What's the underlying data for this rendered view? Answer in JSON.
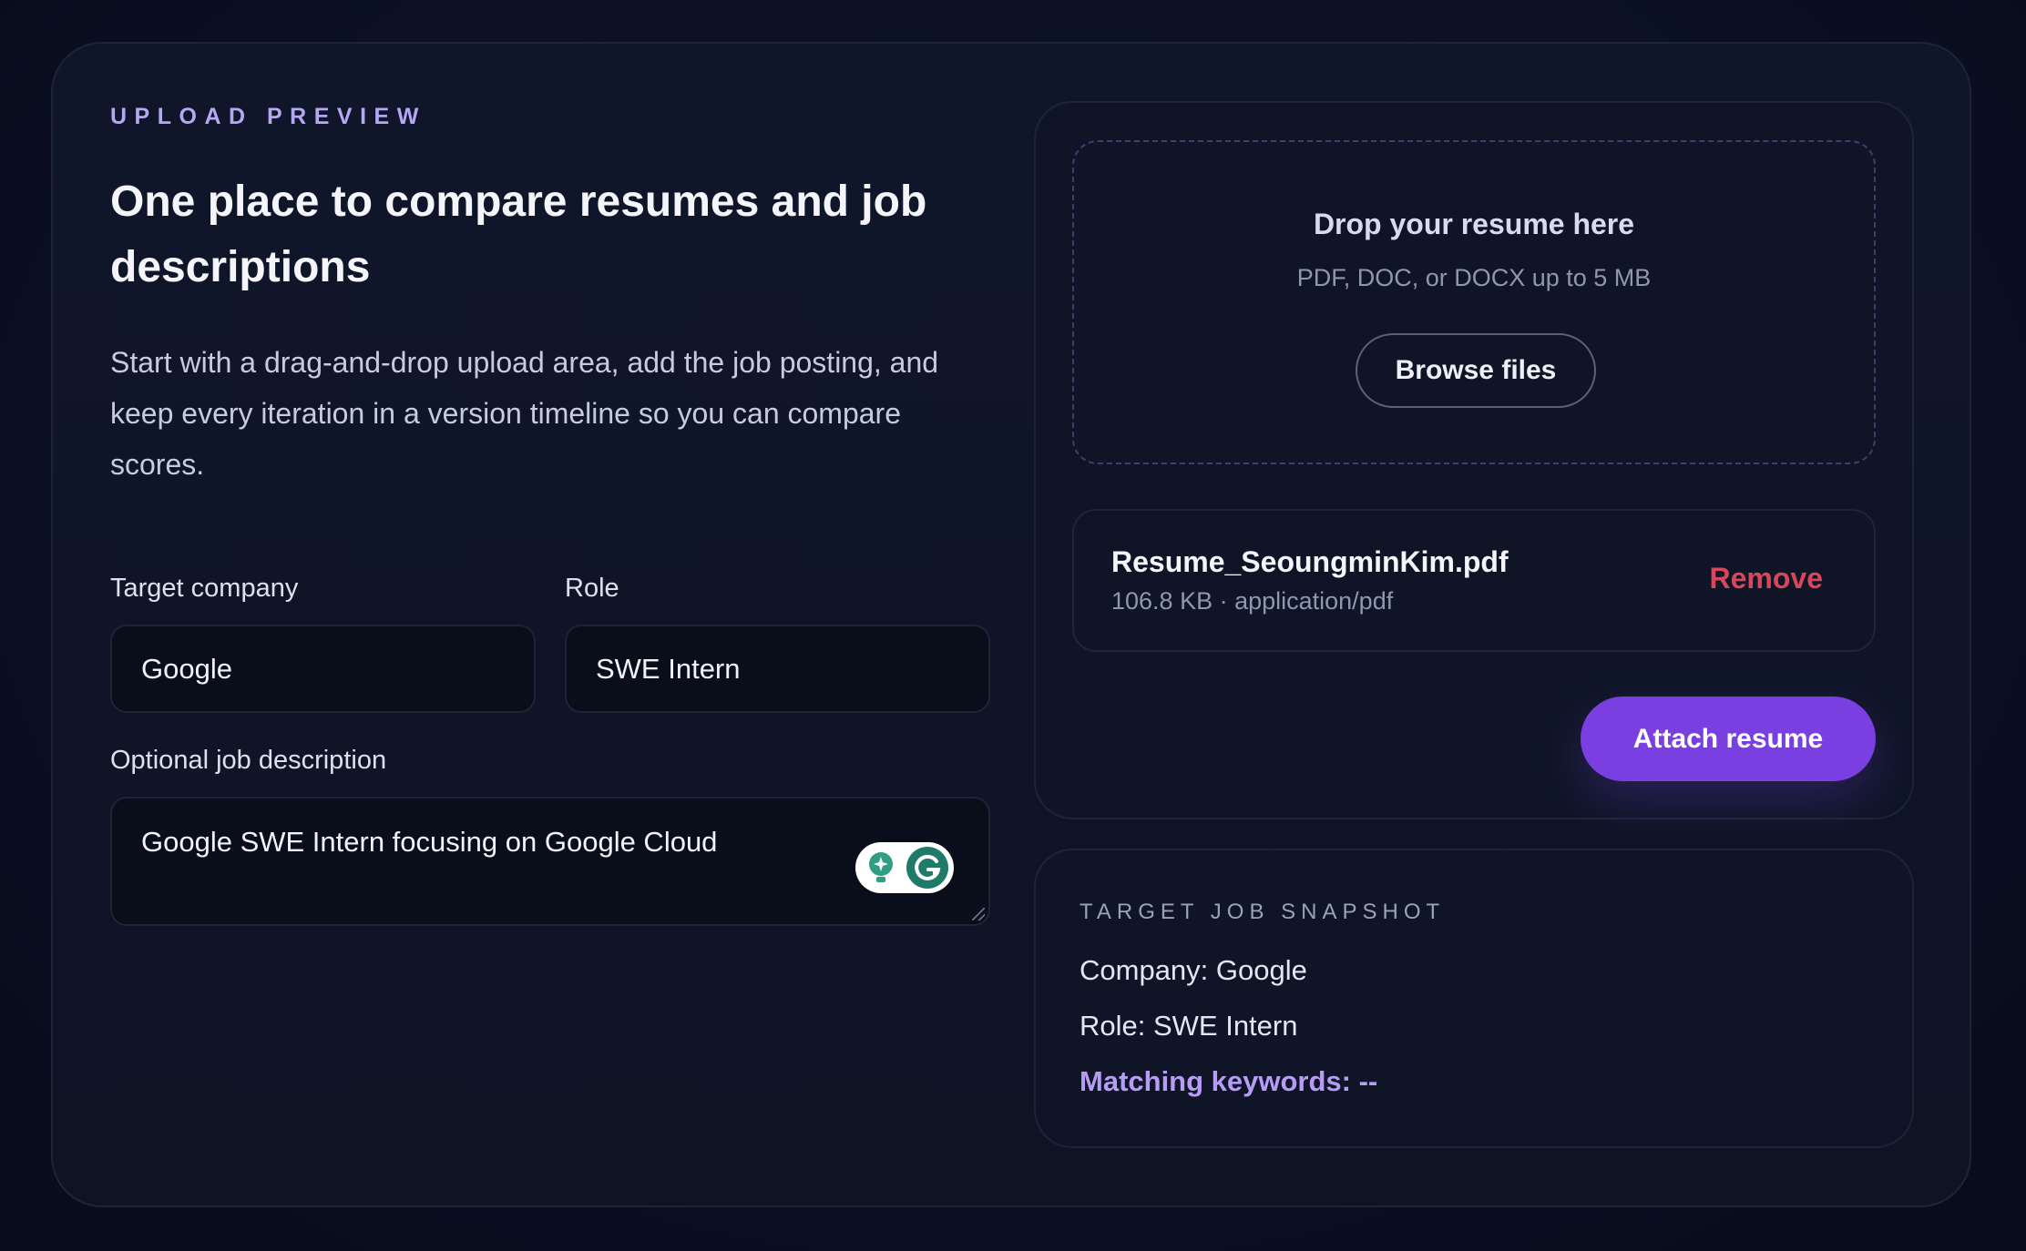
{
  "intro": {
    "eyebrow": "UPLOAD PREVIEW",
    "headline": "One place to compare resumes and job descriptions",
    "description": "Start with a drag-and-drop upload area, add the job posting, and keep every iteration in a version timeline so you can compare scores."
  },
  "form": {
    "company_label": "Target company",
    "company_value": "Google",
    "role_label": "Role",
    "role_value": "SWE Intern",
    "jd_label": "Optional job description",
    "jd_value": "Google SWE Intern focusing on Google Cloud"
  },
  "upload": {
    "drop_title": "Drop your resume here",
    "drop_hint": "PDF, DOC, or DOCX up to 5 MB",
    "browse_label": "Browse files",
    "file_name": "Resume_SeoungminKim.pdf",
    "file_meta": "106.8 KB · application/pdf",
    "remove_label": "Remove",
    "attach_label": "Attach resume"
  },
  "snapshot": {
    "title": "TARGET JOB SNAPSHOT",
    "company_line": "Company: Google",
    "role_line": "Role: SWE Intern",
    "keywords_line": "Matching keywords: --"
  },
  "colors": {
    "accent": "#7a3fe0",
    "eyebrow": "#b6a7f5",
    "danger": "#d9455b",
    "keywords": "#b69cf5"
  },
  "icons": {
    "grammarly_bulb": "grammarly-suggestion-icon",
    "grammarly_logo": "grammarly-logo-icon"
  }
}
